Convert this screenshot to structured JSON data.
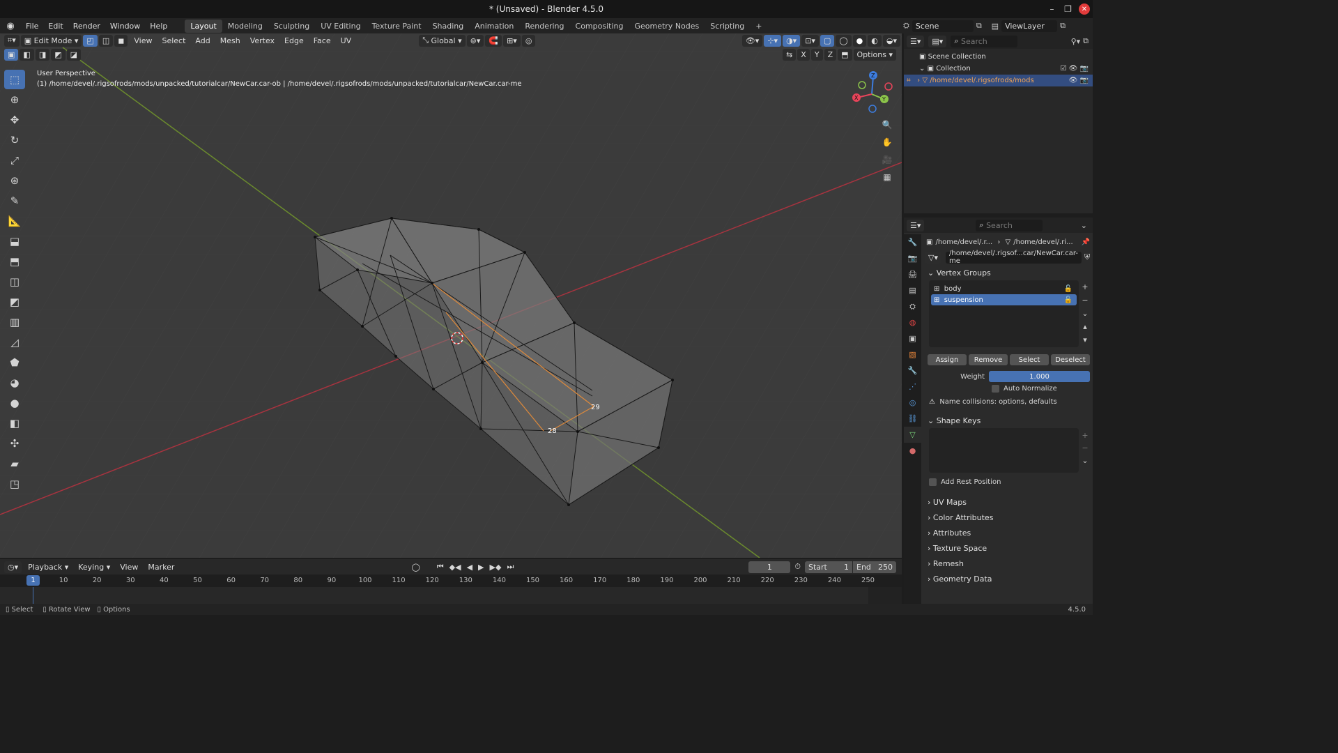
{
  "window": {
    "title": "* (Unsaved) - Blender 4.5.0",
    "controls": [
      "–",
      "❐",
      "✕"
    ]
  },
  "menubar": {
    "items": [
      "File",
      "Edit",
      "Render",
      "Window",
      "Help"
    ],
    "workspaces": [
      "Layout",
      "Modeling",
      "Sculpting",
      "UV Editing",
      "Texture Paint",
      "Shading",
      "Animation",
      "Rendering",
      "Compositing",
      "Geometry Nodes",
      "Scripting"
    ],
    "add": "+"
  },
  "scene": {
    "scene_name": "Scene",
    "view_layer": "ViewLayer"
  },
  "viewport": {
    "mode": "Edit Mode",
    "menus": [
      "View",
      "Select",
      "Add",
      "Mesh",
      "Vertex",
      "Edge",
      "Face",
      "UV"
    ],
    "orientation": "Global",
    "options": "Options",
    "axes": [
      "X",
      "Y",
      "Z"
    ],
    "overlay_line1": "User Perspective",
    "overlay_line2": "(1) /home/devel/.rigsofrods/mods/unpacked/tutorialcar/NewCar.car-ob | /home/devel/.rigsofrods/mods/unpacked/tutorialcar/NewCar.car-me",
    "vertex_labels": [
      "29",
      "28"
    ],
    "gizmo": {
      "z": "Z",
      "y": "Y",
      "x": "X"
    }
  },
  "outliner": {
    "search_placeholder": "Search",
    "rows": [
      {
        "label": "Scene Collection"
      },
      {
        "label": "Collection"
      },
      {
        "label": "/home/devel/.rigsofrods/mods/ur"
      }
    ]
  },
  "properties": {
    "search_placeholder": "Search",
    "breadcrumb": [
      "/home/devel/.r...",
      "/home/devel/.ri..."
    ],
    "mesh_name": "/home/devel/.rigsof...car/NewCar.car-me",
    "vertex_groups": {
      "title": "Vertex Groups",
      "items": [
        "body",
        "suspension"
      ],
      "selected_index": 1,
      "buttons": [
        "Assign",
        "Remove",
        "Select",
        "Deselect"
      ],
      "weight_label": "Weight",
      "weight_value": "1.000",
      "auto_normalize": "Auto Normalize",
      "warning": "Name collisions: options, defaults"
    },
    "shape_keys": {
      "title": "Shape Keys",
      "add_rest_position": "Add Rest Position"
    },
    "collapsed_panels": [
      "UV Maps",
      "Color Attributes",
      "Attributes",
      "Texture Space",
      "Remesh",
      "Geometry Data"
    ]
  },
  "timeline": {
    "menus": [
      "Playback",
      "Keying",
      "View",
      "Marker"
    ],
    "current_frame": "1",
    "start_label": "Start",
    "start": "1",
    "end_label": "End",
    "end": "250",
    "ticks": [
      "10",
      "20",
      "30",
      "40",
      "50",
      "60",
      "70",
      "80",
      "90",
      "100",
      "110",
      "120",
      "130",
      "140",
      "150",
      "160",
      "170",
      "180",
      "190",
      "200",
      "210",
      "220",
      "230",
      "240",
      "250"
    ],
    "playhead": "1"
  },
  "statusbar": {
    "items": [
      "Select",
      "Rotate View",
      "Options"
    ],
    "version": "4.5.0"
  },
  "colors": {
    "accent": "#4772b3",
    "x_axis": "#e8445a",
    "y_axis": "#8bc34a",
    "z_axis": "#3d7de0",
    "selected_object": "#f3a455"
  }
}
